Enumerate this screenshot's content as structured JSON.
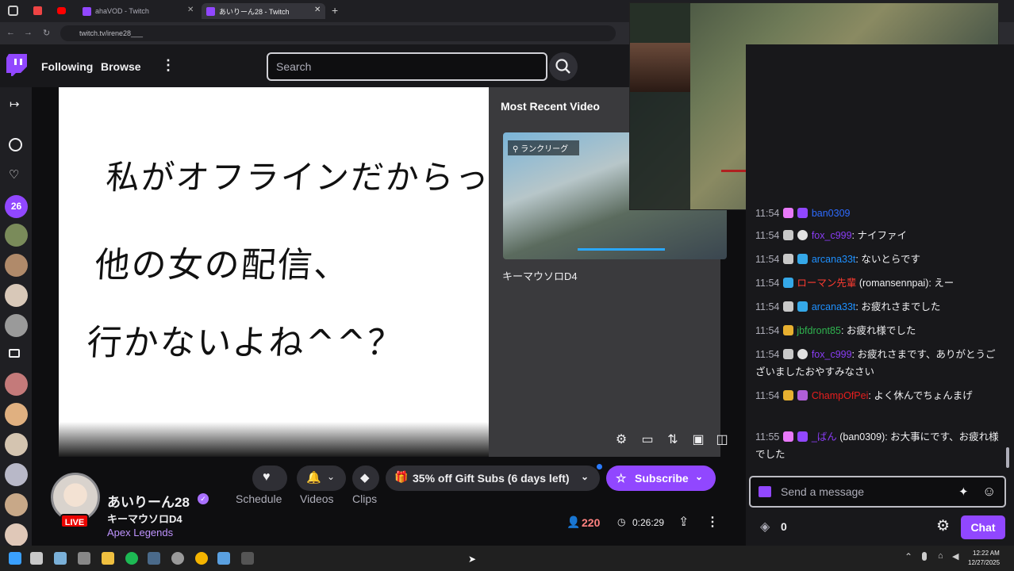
{
  "browser": {
    "tabs": [
      {
        "label": "ahaVOD - Twitch"
      },
      {
        "label": "あいりーん28 - Twitch"
      }
    ],
    "new_tab": "+",
    "url": "twitch.tv/irene28___"
  },
  "topnav": {
    "following": "Following",
    "browse": "Browse",
    "search_placeholder": "Search"
  },
  "sidebar": {
    "viewer_badge": "26"
  },
  "offline": {
    "whiteboard_lines": [
      "私がオフラインだからって",
      "他の女の配信、",
      "行かないよね^^？"
    ],
    "recent_title": "Most Recent Video",
    "thumb_tag": "ランクリーグ",
    "video_title": "キーマウソロD4"
  },
  "channel": {
    "name": "あいりーん28",
    "stream_title": "キーマウソロD4",
    "category": "Apex Legends",
    "live_label": "LIVE",
    "viewers": "220",
    "uptime": "0:26:29",
    "actions": {
      "schedule": "Schedule",
      "videos": "Videos",
      "clips": "Clips"
    },
    "gift_subs": "35% off Gift Subs (6 days left)",
    "subscribe": "Subscribe"
  },
  "chat": {
    "messages": [
      {
        "time": "11:54",
        "user": "ban0309",
        "user_color": "#2e6bff",
        "text": ""
      },
      {
        "time": "11:54",
        "user": "fox_c999",
        "user_color": "#8a3cf5",
        "text": ": ナイファイ"
      },
      {
        "time": "11:54",
        "user": "arcana33t",
        "user_color": "#1e90ff",
        "text": ": ないとらです"
      },
      {
        "time": "11:54",
        "user": "ローマン先輩",
        "user_color": "#ff3b30",
        "text": " (romansennpai): えー"
      },
      {
        "time": "11:54",
        "user": "arcana33t",
        "user_color": "#1e90ff",
        "text": ": お疲れさまでした"
      },
      {
        "time": "11:54",
        "user": "jbfdront85",
        "user_color": "#2fb34f",
        "text": ": お疲れ様でした"
      },
      {
        "time": "11:54",
        "user": "fox_c999",
        "user_color": "#8a3cf5",
        "text": ": お疲れさまです、ありがとうございましたおやすみなさい"
      },
      {
        "time": "11:54",
        "user": "ChampOfPei",
        "user_color": "#e81e1e",
        "text": ": よく休んでちょんまげ"
      },
      {
        "time": "11:55",
        "user": "_ばん",
        "user_color": "#8a3cf5",
        "text": " (ban0309): お大事にです、お疲れ様でした"
      }
    ],
    "input_placeholder": "Send a message",
    "points": "0",
    "chat_button": "Chat"
  },
  "taskbar": {
    "time": "12:22 AM",
    "date": "12/27/2025"
  }
}
